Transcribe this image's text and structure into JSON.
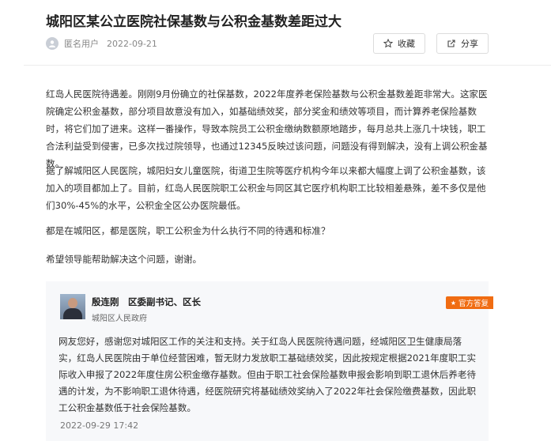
{
  "article": {
    "title": "城阳区某公立医院社保基数与公积金基数差距过大",
    "author": "匿名用户",
    "date": "2022-09-21",
    "favorite_label": "收藏",
    "share_label": "分享",
    "paragraphs": [
      "红岛人民医院待遇差。刚刚9月份确立的社保基数，2022年度养老保险基数与公积金基数差距非常大。这家医院确定公积金基数，部分项目故意没有加入，如基础绩效奖，部分奖金和绩效等项目，而计算养老保险基数时，将它们加了进来。这样一番操作，导致本院员工公积金缴纳数额原地踏步，每月总共上涨几十块钱，职工合法利益受到侵害，已多次找过院领导，也通过12345反映过该问题，问题没有得到解决，没有上调公积金基数。",
      "据了解城阳区人民医院，城阳妇女儿童医院，街道卫生院等医疗机构今年以来都大幅度上调了公积金基数，该加入的项目都加上了。目前，红岛人民医院职工公积金与同区其它医疗机构职工比较相差悬殊，差不多仅是他们30%-45%的水平，公积金全区公办医院最低。",
      "都是在城阳区，都是医院，职工公积金为什么执行不同的待遇和标准？",
      "希望领导能帮助解决这个问题，谢谢。"
    ]
  },
  "reply": {
    "official_name": "殷连刚　区委副书记、区长",
    "department": "城阳区人民政府",
    "badge_label": "官方答复",
    "text": "网友您好，感谢您对城阳区工作的关注和支持。关于红岛人民医院待遇问题，经城阳区卫生健康局落实，红岛人民医院由于单位经营困难，暂无财力发放职工基础绩效奖，因此按规定根据2021年度职工实际收入申报了2022年度住房公积金缴存基数。但由于职工社会保险基数申报会影响到职工退休后养老待遇的计发，为不影响职工退休待遇，经医院研究将基础绩效奖纳入了2022年社会保险缴费基数，因此职工公积金基数低于社会保险基数。",
    "date": "2022-09-29 17:42"
  },
  "colors": {
    "badge": "#f06c12",
    "reply_background": "#f7f8fa"
  },
  "icons": {
    "favorite": "star-outline-icon",
    "share": "share-arrow-icon",
    "badge": "star-icon"
  }
}
